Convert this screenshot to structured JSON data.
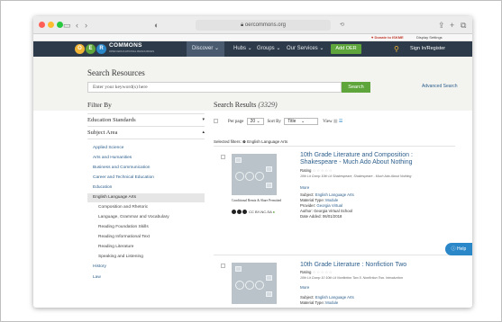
{
  "browser": {
    "url": "oercommons.org",
    "colors": {
      "red": "#ff5f57",
      "yellow": "#febc2e",
      "green": "#28c840"
    }
  },
  "topbar": {
    "donate": "♥ Donate to ISKME",
    "display_settings": "Display Settings"
  },
  "nav": {
    "logo_letters": [
      "O",
      "E",
      "R"
    ],
    "logo_text": "COMMONS",
    "logo_sub": "OPEN EDUCATIONAL RESOURCES",
    "discover": "Discover ⌄",
    "hubs": "Hubs ⌄",
    "groups": "Groups ⌄",
    "services": "Our Services ⌄",
    "add_oer": "Add OER",
    "sign_in": "Sign In/Register",
    "colors": {
      "bar": "#2d3a49",
      "green": "#5ea63c",
      "accent": "#f1b535"
    }
  },
  "search": {
    "title": "Search Resources",
    "placeholder": "Enter your keyword(s) here",
    "button": "Search",
    "advanced": "Advanced Search"
  },
  "filter": {
    "title": "Filter By",
    "education_standards": "Education Standards",
    "subject_area": "Subject Area",
    "items": [
      "Applied Science",
      "Arts and Humanities",
      "Business and Communication",
      "Career and Technical Education",
      "Education",
      "English Language Arts",
      "Composition and Rhetoric",
      "Language, Grammar and Vocabulary",
      "Reading Foundation Skills",
      "Reading Informational Text",
      "Reading Literature",
      "Speaking and Listening",
      "History",
      "Law"
    ]
  },
  "results": {
    "title": "Search Results",
    "count": "(3329)",
    "per_page_label": "Per page",
    "per_page_value": "20",
    "sort_label": "Sort By",
    "sort_value": "Title",
    "view_label": "View",
    "selected_filters_label": "Selected filters:",
    "selected_filter": "English Language Arts",
    "cards": [
      {
        "title": "10th Grade Literature and Composition : Shakespeare - Much Ado About Nothing",
        "rating_label": "Rating",
        "stars": "☆☆☆☆☆",
        "desc": "10th Lit Comp 10th Lit Shakespeare, Shakespeare - Much Ado About Nothing",
        "more": "More",
        "subject_label": "Subject:",
        "subject": "English Language Arts",
        "type_label": "Material Type:",
        "type": "Module",
        "provider_label": "Provider:",
        "provider": "Georgia Virtual",
        "author_label": "Author:",
        "author": "Georgia Virtual School",
        "date_label": "Date Added:",
        "date": "06/01/2018",
        "remix": "Conditional Remix & Share Permitted",
        "license": "CC BY-NC-SA"
      },
      {
        "title": "10th Grade Literature : Nonfiction Two",
        "rating_label": "Rating",
        "stars": "☆☆☆☆☆",
        "desc": "10th Lit Comp 10 10th Lit Nonfiction Two 5. Nonfiction Two. Introduction",
        "more": "More",
        "subject_label": "Subject:",
        "subject": "English Language Arts",
        "type_label": "Material Type:",
        "type": "Module"
      }
    ]
  },
  "help": "ⓘ Help"
}
